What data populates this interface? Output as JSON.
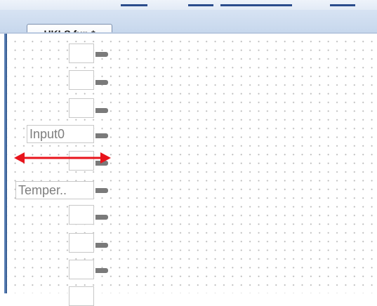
{
  "editor": {
    "tab_title": "HKLS.fup *"
  },
  "diagram": {
    "input_labels": [
      "Input0",
      "Temper.."
    ]
  },
  "colors": {
    "tab_border": "#7c8fae",
    "canvas_dot": "#b9b9b9",
    "pin": "#7a7a7a",
    "arrow": "#e8141c",
    "left_edge": "#5f84b8"
  },
  "icons": {
    "resize_arrow": "double-headed-horizontal-arrow"
  }
}
